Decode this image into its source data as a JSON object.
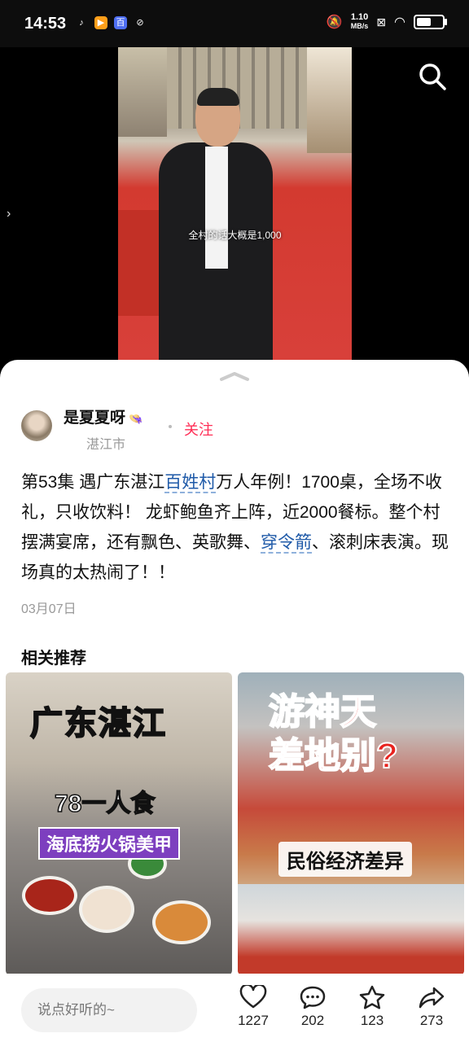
{
  "status_bar": {
    "time": "14:53",
    "net_speed": "1.10",
    "net_unit": "MB/s",
    "app_icons": [
      "douyin-icon",
      "video-app-icon",
      "baidu-icon",
      "link-icon"
    ],
    "battery_level": 0.55
  },
  "video": {
    "subtitle": "全村的话大概是1,000"
  },
  "post": {
    "author_name": "是夏夏呀",
    "author_emoji": "👒",
    "location": "湛江市",
    "follow_label": "关注",
    "desc_part1": "第53集   遇广东湛江",
    "tag1": "百姓村",
    "desc_part2": "万人年例！1700桌，全场不收礼，只收饮料！ 龙虾鲍鱼齐上阵，近2000餐标。整个村摆满宴席，还有飘色、英歌舞、",
    "tag2": "穿令箭",
    "desc_part3": "、滚刺床表演。现场真的太热闹了！！",
    "date": "03月07日"
  },
  "recommend": {
    "title": "相关推荐",
    "cards": [
      {
        "title": "广东湛江",
        "subtitle": "78一人食",
        "caption": "海底捞火锅美甲"
      },
      {
        "title_line1": "游神天",
        "title_line2": "差地别?",
        "caption": "民俗经济差异"
      }
    ]
  },
  "bottom_bar": {
    "comment_placeholder": "说点好听的~",
    "likes": "1227",
    "comments": "202",
    "favorites": "123",
    "shares": "273"
  },
  "colors": {
    "follow": "#ff2d55",
    "tag": "#1f5aa8",
    "background": "#ffffff"
  }
}
